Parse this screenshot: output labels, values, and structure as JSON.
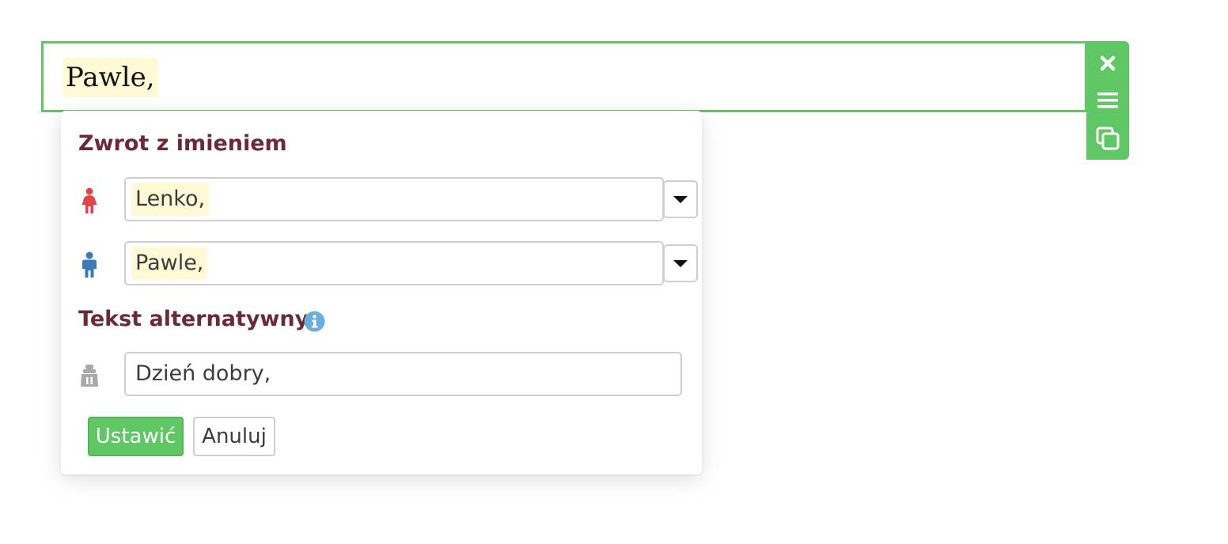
{
  "editor": {
    "text": "Pawle,"
  },
  "toolbar": {
    "icons": [
      "close-icon",
      "menu-icon",
      "copy-icon"
    ],
    "color": "#5fc764"
  },
  "popup": {
    "section_name_title": "Zwrot z imieniem",
    "female_field": {
      "icon": "female-icon",
      "value": "Lenko,"
    },
    "male_field": {
      "icon": "male-icon",
      "value": "Pawle,"
    },
    "section_alt_title": "Tekst alternatywny",
    "alt_field": {
      "icon": "neutral-person-icon",
      "value": "Dzień dobry,"
    },
    "set_button_label": "Ustawić",
    "cancel_button_label": "Anuluj"
  },
  "colors": {
    "accent": "#5fc764",
    "title": "#6b2a35",
    "highlight": "#fff9d6",
    "female": "#e0454a",
    "male": "#3a7ab8",
    "info": "#6aaee0"
  }
}
